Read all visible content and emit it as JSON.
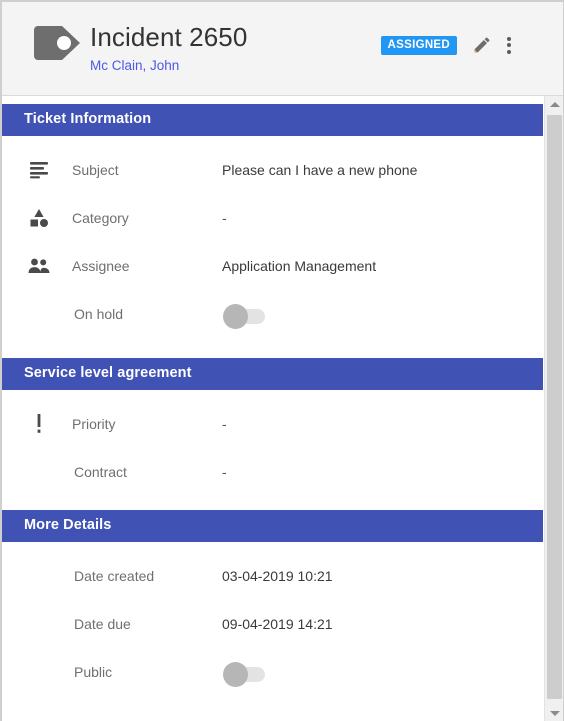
{
  "header": {
    "tag_icon": "tag-icon",
    "title": "Incident 2650",
    "subtitle": "Mc Clain, John",
    "status_badge": "ASSIGNED",
    "edit_icon": "pencil-icon",
    "more_icon": "more-vertical-icon",
    "accent_color": "#2196f3",
    "link_color": "#4b5ae4",
    "background_color": "#f4f4f4"
  },
  "sections": [
    {
      "title": "Ticket Information",
      "header_color": "#4052b4",
      "rows": [
        {
          "icon": "subject-lines-icon",
          "label": "Subject",
          "value": "Please can I have a new phone",
          "type": "text"
        },
        {
          "icon": "category-shapes-icon",
          "label": "Category",
          "value": "-",
          "type": "text"
        },
        {
          "icon": "people-icon",
          "label": "Assignee",
          "value": "Application Management",
          "type": "text"
        },
        {
          "icon": "",
          "label": "On hold",
          "value": "off",
          "type": "toggle"
        }
      ]
    },
    {
      "title": "Service level agreement",
      "header_color": "#4052b4",
      "rows": [
        {
          "icon": "exclamation-icon",
          "label": "Priority",
          "value": "-",
          "type": "text"
        },
        {
          "icon": "",
          "label": "Contract",
          "value": "-",
          "type": "text"
        }
      ]
    },
    {
      "title": "More Details",
      "header_color": "#4052b4",
      "rows": [
        {
          "icon": "",
          "label": "Date created",
          "value": "03-04-2019 10:21",
          "type": "text"
        },
        {
          "icon": "",
          "label": "Date due",
          "value": "09-04-2019 14:21",
          "type": "text"
        },
        {
          "icon": "",
          "label": "Public",
          "value": "off",
          "type": "toggle"
        }
      ]
    }
  ],
  "scrollbar": {
    "up_arrow": "scroll-up-arrow",
    "down_arrow": "scroll-down-arrow"
  }
}
